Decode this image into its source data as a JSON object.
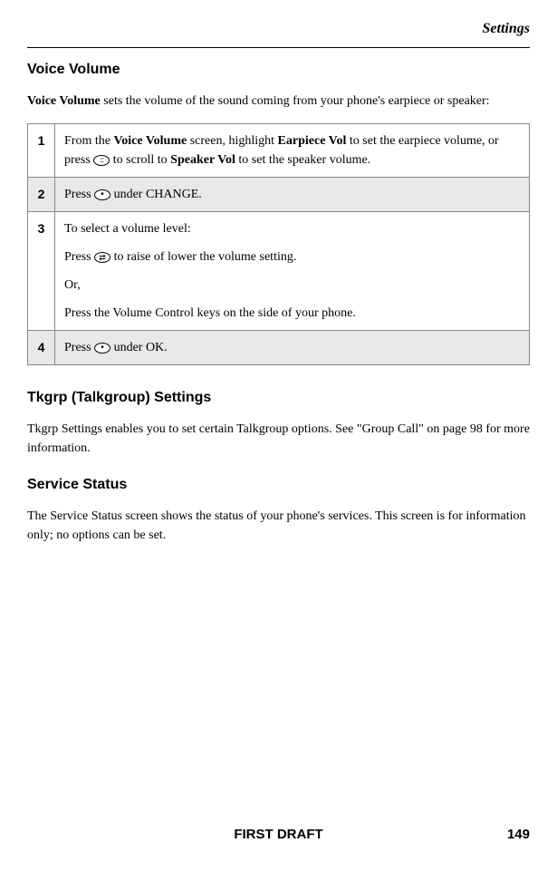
{
  "header": {
    "category": "Settings"
  },
  "sections": {
    "voiceVolume": {
      "title": "Voice Volume",
      "introBold": "Voice Volume",
      "introRest": " sets the volume of the sound coming from your phone's earpiece or speaker:"
    },
    "tkgrp": {
      "title": "Tkgrp (Talkgroup) Settings",
      "body": "Tkgrp Settings enables you to set certain Talkgroup options. See \"Group Call\" on page 98 for more information."
    },
    "serviceStatus": {
      "title": "Service Status",
      "body": "The Service Status screen shows the status of your phone's services. This screen is for information only; no options can be set."
    }
  },
  "steps": [
    {
      "num": "1",
      "pre": "From the ",
      "bold1": "Voice Volume",
      "mid1": " screen, highlight ",
      "bold2": "Earpiece Vol",
      "mid2": " to set the earpiece volume, or press ",
      "iconType": "dots",
      "mid3": " to scroll to ",
      "bold3": "Speaker Vol",
      "post": " to set the speaker volume."
    },
    {
      "num": "2",
      "pre": "Press ",
      "iconType": "dot",
      "post": " under CHANGE."
    },
    {
      "num": "3",
      "line1": "To select a volume level:",
      "line2pre": "Press ",
      "iconType": "arrows",
      "line2post": " to raise of lower the volume setting.",
      "line3": "Or,",
      "line4": "Press the Volume Control keys on the side of your phone."
    },
    {
      "num": "4",
      "pre": "Press ",
      "iconType": "dot",
      "post": " under OK."
    }
  ],
  "footer": {
    "center": "FIRST DRAFT",
    "pageNum": "149"
  }
}
